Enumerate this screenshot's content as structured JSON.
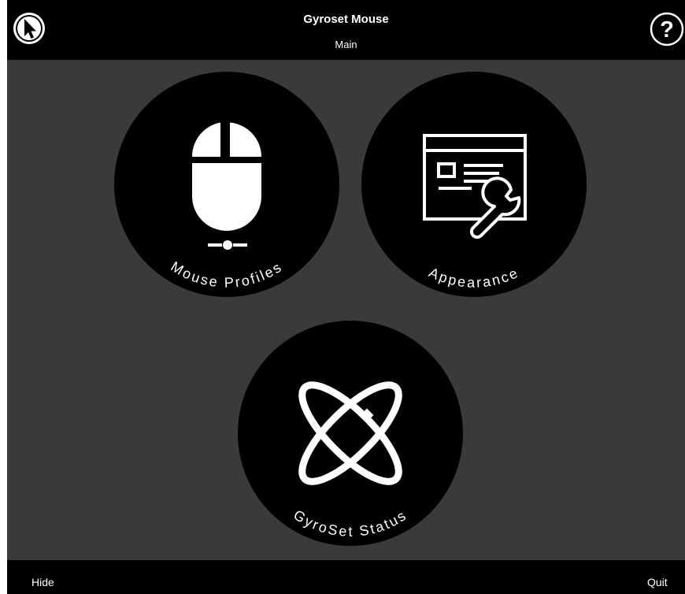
{
  "window": {
    "title": "Gyroset Mouse",
    "subtitle": "Main"
  },
  "header": {
    "left_icon": "cursor-arrow-icon",
    "right_icon": "help-question-icon",
    "help_glyph": "?"
  },
  "menu": [
    {
      "id": "mouse-profiles",
      "label": "Mouse Profiles",
      "icon": "mouse-icon"
    },
    {
      "id": "appearance",
      "label": "Appearance",
      "icon": "window-wrench-icon"
    },
    {
      "id": "gyroset-status",
      "label": "GyroSet Status",
      "icon": "gyro-orbit-icon"
    }
  ],
  "footer": {
    "hide_label": "Hide",
    "quit_label": "Quit"
  },
  "colors": {
    "background": "#3a3a3a",
    "bar": "#000000",
    "circle": "#000000",
    "foreground": "#ffffff"
  }
}
